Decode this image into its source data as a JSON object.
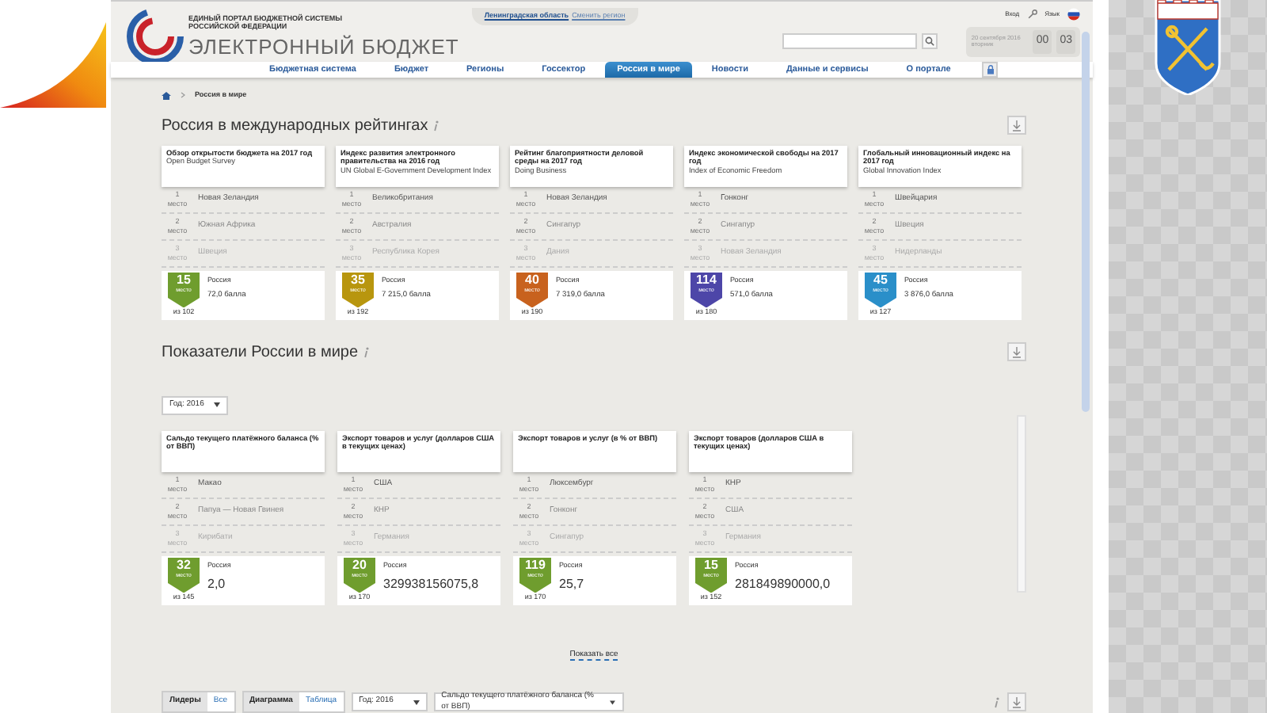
{
  "header": {
    "tagline": "ЕДИНЫЙ ПОРТАЛ БЮДЖЕТНОЙ СИСТЕМЫ РОССИЙСКОЙ ФЕДЕРАЦИИ",
    "title": "ЭЛЕКТРОННЫЙ БЮДЖЕТ",
    "region": "Ленинградская область",
    "change_region": "Сменить регион",
    "date": "20 сентября 2016",
    "weekday": "вторник",
    "clock": [
      "00",
      "03"
    ],
    "login": "Вход",
    "language": "Язык"
  },
  "nav": [
    {
      "label": "Бюджетная система",
      "selected": false
    },
    {
      "label": "Бюджет",
      "selected": false
    },
    {
      "label": "Регионы",
      "selected": false
    },
    {
      "label": "Госсектор",
      "selected": false
    },
    {
      "label": "Россия в мире",
      "selected": true
    },
    {
      "label": "Новости",
      "selected": false
    },
    {
      "label": "Данные и сервисы",
      "selected": false
    },
    {
      "label": "О портале",
      "selected": false
    }
  ],
  "breadcrumb": "Россия в мире",
  "ratings": {
    "title": "Россия в международных рейтингах",
    "cards": [
      {
        "title": "Обзор открытости бюджета на 2017 год",
        "subtitle": "Open Budget Survey",
        "leaders": [
          {
            "place": "1",
            "unit": "место",
            "country": "Новая Зеландия"
          },
          {
            "place": "2",
            "unit": "место",
            "country": "Южная Африка"
          },
          {
            "place": "3",
            "unit": "место",
            "country": "Швеция"
          }
        ],
        "russia": {
          "place": "15",
          "unit": "место",
          "color": "#6f9d2e",
          "country": "Россия",
          "value": "72,0 балла",
          "total": "из 102"
        }
      },
      {
        "title": "Индекс развития электронного правительства на 2016 год",
        "subtitle": "UN Global E-Government Development Index",
        "leaders": [
          {
            "place": "1",
            "unit": "место",
            "country": "Великобритания"
          },
          {
            "place": "2",
            "unit": "место",
            "country": "Австралия"
          },
          {
            "place": "3",
            "unit": "место",
            "country": "Республика Корея"
          }
        ],
        "russia": {
          "place": "35",
          "unit": "место",
          "color": "#b8960e",
          "country": "Россия",
          "value": "7 215,0 балла",
          "total": "из 192"
        }
      },
      {
        "title": "Рейтинг благоприятности деловой среды на 2017 год",
        "subtitle": "Doing Business",
        "leaders": [
          {
            "place": "1",
            "unit": "место",
            "country": "Новая Зеландия"
          },
          {
            "place": "2",
            "unit": "место",
            "country": "Сингапур"
          },
          {
            "place": "3",
            "unit": "место",
            "country": "Дания"
          }
        ],
        "russia": {
          "place": "40",
          "unit": "место",
          "color": "#c8621e",
          "country": "Россия",
          "value": "7 319,0 балла",
          "total": "из 190"
        }
      },
      {
        "title": "Индекс экономической свободы на 2017 год",
        "subtitle": "Index of Economic Freedom",
        "leaders": [
          {
            "place": "1",
            "unit": "место",
            "country": "Гонконг"
          },
          {
            "place": "2",
            "unit": "место",
            "country": "Сингапур"
          },
          {
            "place": "3",
            "unit": "место",
            "country": "Новая Зеландия"
          }
        ],
        "russia": {
          "place": "114",
          "unit": "место",
          "color": "#4d46a8",
          "country": "Россия",
          "value": "571,0 балла",
          "total": "из 180"
        }
      },
      {
        "title": "Глобальный инновационный индекс на 2017 год",
        "subtitle": "Global Innovation Index",
        "leaders": [
          {
            "place": "1",
            "unit": "место",
            "country": "Швейцария"
          },
          {
            "place": "2",
            "unit": "место",
            "country": "Швеция"
          },
          {
            "place": "3",
            "unit": "место",
            "country": "Нидерланды"
          }
        ],
        "russia": {
          "place": "45",
          "unit": "место",
          "color": "#2a8fc9",
          "country": "Россия",
          "value": "3 876,0 балла",
          "total": "из 127"
        }
      }
    ]
  },
  "indicators": {
    "title": "Показатели России в мире",
    "year_select": "Год: 2016",
    "cards": [
      {
        "title": "Сальдо текущего платёжного баланса (% от ВВП)",
        "leaders": [
          {
            "place": "1",
            "unit": "место",
            "country": "Макао"
          },
          {
            "place": "2",
            "unit": "место",
            "country": "Папуа — Новая Гвинея"
          },
          {
            "place": "3",
            "unit": "место",
            "country": "Кирибати"
          }
        ],
        "russia": {
          "place": "32",
          "unit": "место",
          "color": "#6f9d2e",
          "country": "Россия",
          "value": "2,0",
          "total": "из 145"
        }
      },
      {
        "title": "Экспорт товаров и услуг (долларов США в текущих ценах)",
        "leaders": [
          {
            "place": "1",
            "unit": "место",
            "country": "США"
          },
          {
            "place": "2",
            "unit": "место",
            "country": "КНР"
          },
          {
            "place": "3",
            "unit": "место",
            "country": "Германия"
          }
        ],
        "russia": {
          "place": "20",
          "unit": "место",
          "color": "#6f9d2e",
          "country": "Россия",
          "value": "329938156075,8",
          "total": "из 170"
        }
      },
      {
        "title": "Экспорт товаров и услуг (в % от ВВП)",
        "leaders": [
          {
            "place": "1",
            "unit": "место",
            "country": "Люксембург"
          },
          {
            "place": "2",
            "unit": "место",
            "country": "Гонконг"
          },
          {
            "place": "3",
            "unit": "место",
            "country": "Сингапур"
          }
        ],
        "russia": {
          "place": "119",
          "unit": "место",
          "color": "#6f9d2e",
          "country": "Россия",
          "value": "25,7",
          "total": "из 170"
        }
      },
      {
        "title": "Экспорт товаров (долларов США в текущих ценах)",
        "leaders": [
          {
            "place": "1",
            "unit": "место",
            "country": "КНР"
          },
          {
            "place": "2",
            "unit": "место",
            "country": "США"
          },
          {
            "place": "3",
            "unit": "место",
            "country": "Германия"
          }
        ],
        "russia": {
          "place": "15",
          "unit": "место",
          "color": "#6f9d2e",
          "country": "Россия",
          "value": "281849890000,0",
          "total": "из 152"
        }
      }
    ],
    "show_all": "Показать все"
  },
  "toolbar": {
    "view_toggle": [
      {
        "label": "Лидеры",
        "selected": true
      },
      {
        "label": "Все",
        "selected": false
      }
    ],
    "mode_toggle": [
      {
        "label": "Диаграмма",
        "selected": true
      },
      {
        "label": "Таблица",
        "selected": false
      }
    ],
    "year_select": "Год: 2016",
    "indicator_select": "Сальдо текущего платёжного баланса (% от ВВП)"
  }
}
